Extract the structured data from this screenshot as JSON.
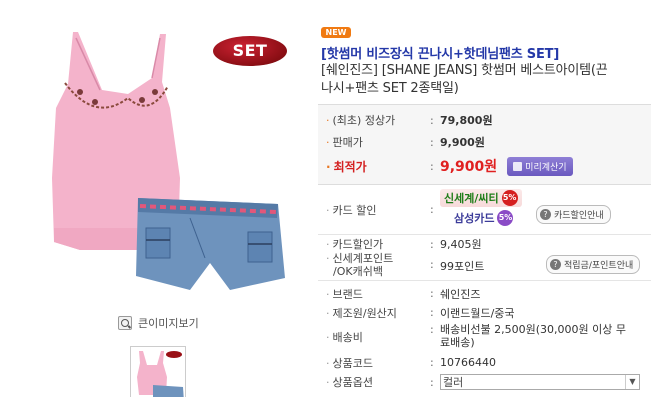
{
  "left": {
    "set_badge": "SET",
    "zoom_label": "큰이미지보기"
  },
  "product": {
    "new_badge": "NEW",
    "title_line": "[핫썸머 비즈장식 끈나시+핫데님팬츠 SET]",
    "subtitle": "[쉐인진즈] [SHANE JEANS] 핫썸머 베스트아이템(끈나시+팬츠 SET 2종택일)"
  },
  "prices": {
    "list_label": "(최초) 정상가",
    "list_price": "79,800원",
    "sale_label": "판매가",
    "sale_price": "9,900원",
    "best_label": "최적가",
    "best_price": "9,900원",
    "calc_button": "미리계산기"
  },
  "card": {
    "label": "카드 할인",
    "tag1": "신세계/씨티",
    "tag1_pct": "5%",
    "tag2": "삼성카드",
    "tag2_pct": "5%",
    "guide_button": "카드할인안내"
  },
  "details": {
    "card_price_label": "카드할인가",
    "card_price": "9,405원",
    "points_label_1": "신세계포인트",
    "points_label_2": "/OK캐쉬백",
    "points_value": "99포인트",
    "points_guide": "적립금/포인트안내",
    "brand_label": "브랜드",
    "brand": "쉐인진즈",
    "origin_label": "제조원/원산지",
    "origin": "이랜드월드/중국",
    "shipping_label": "배송비",
    "shipping": "배송비선불 2,500원(30,000원 이상 무료배송)",
    "code_label": "상품코드",
    "code": "10766440",
    "option_label": "상품옵션",
    "option_value": "컬러"
  }
}
